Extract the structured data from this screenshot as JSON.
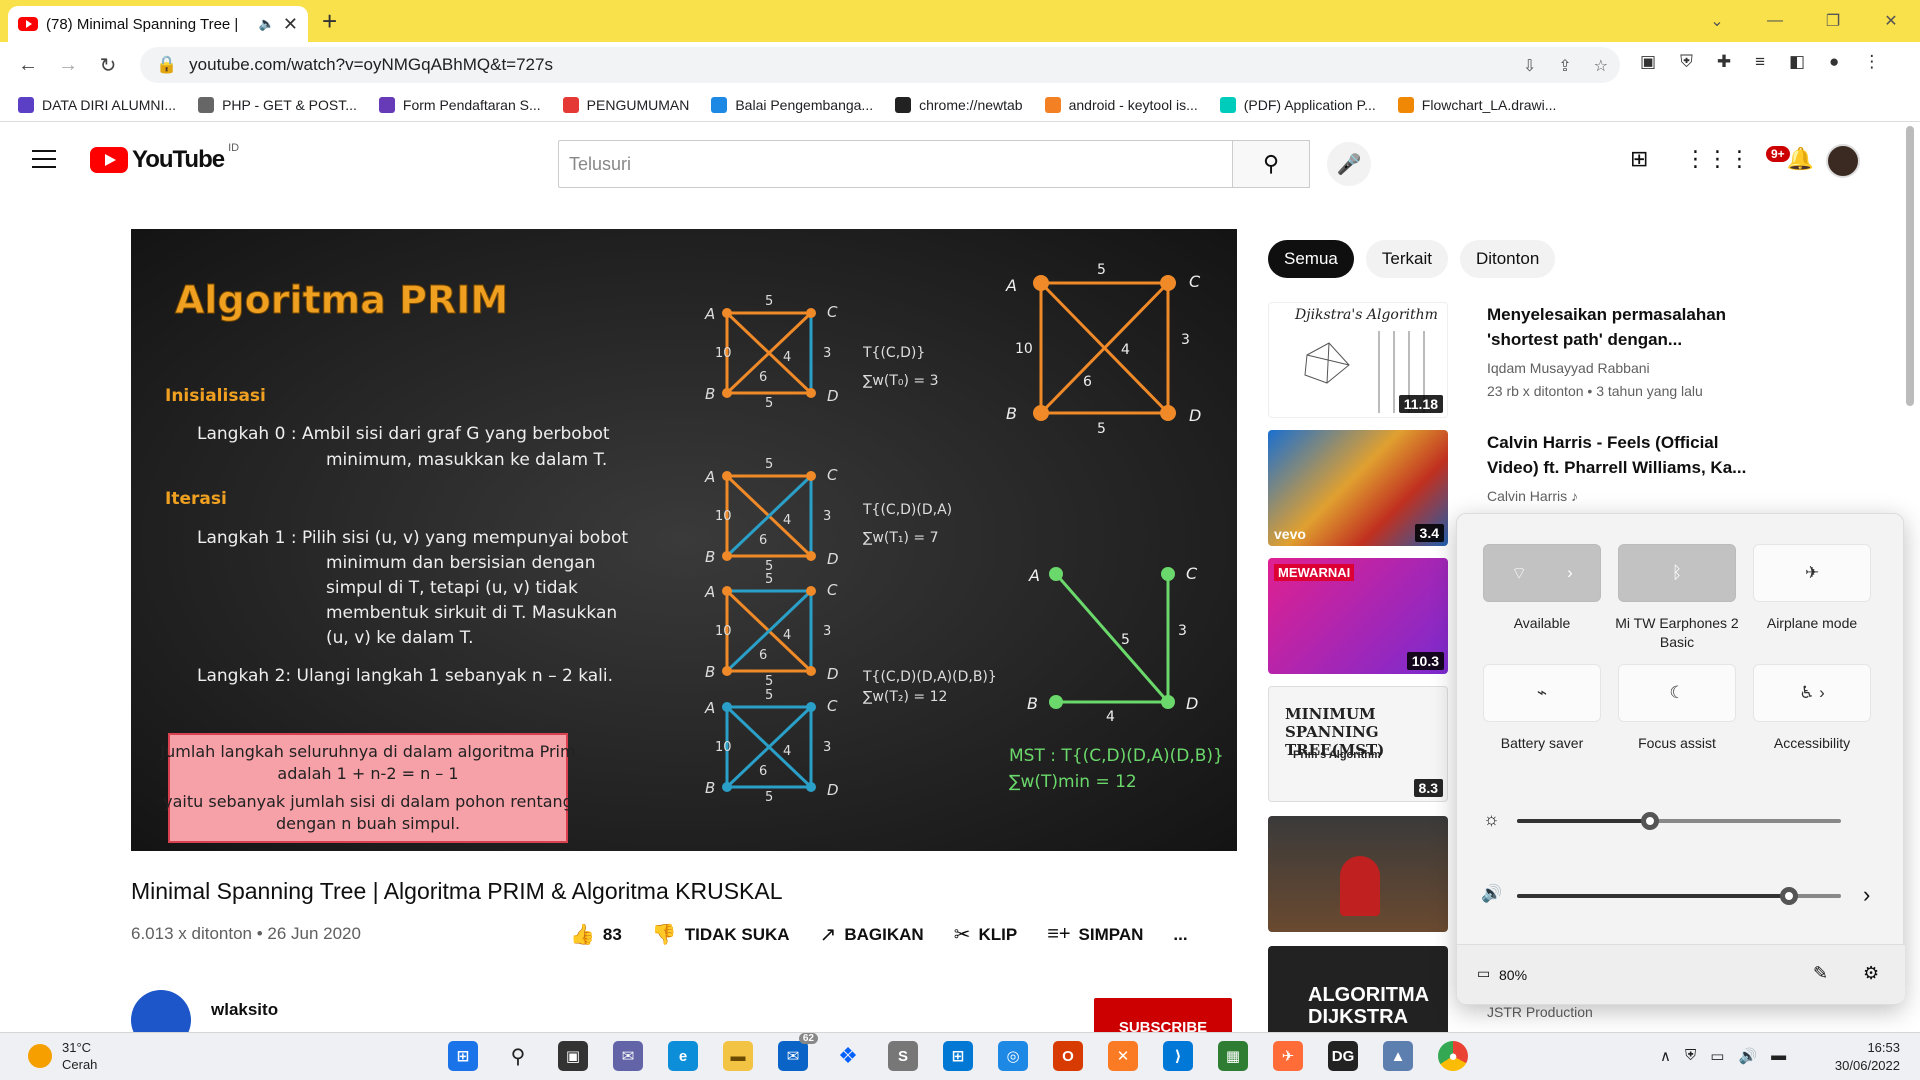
{
  "browser": {
    "tab_title": "(78) Minimal Spanning Tree |",
    "tab_close": "✕",
    "new_tab": "+",
    "url": "youtube.com/watch?v=oyNMGqABhMQ&t=727s",
    "bookmarks": [
      {
        "label": "DATA DIRI ALUMNI...",
        "color": "#5b3fc4"
      },
      {
        "label": "PHP - GET & POST...",
        "color": "#666666"
      },
      {
        "label": "Form Pendaftaran S...",
        "color": "#673ab7"
      },
      {
        "label": "PENGUMUMAN",
        "color": "#e53935"
      },
      {
        "label": "Balai Pengembanga...",
        "color": "#1e88e5"
      },
      {
        "label": "chrome://newtab",
        "color": "#222222"
      },
      {
        "label": "android - keytool is...",
        "color": "#f48024"
      },
      {
        "label": "(PDF) Application P...",
        "color": "#00ccbb"
      },
      {
        "label": "Flowchart_LA.drawi...",
        "color": "#f08705"
      }
    ]
  },
  "youtube": {
    "logo_text": "YouTube",
    "country": "ID",
    "search_placeholder": "Telusuri",
    "notif_count": "9+"
  },
  "video": {
    "title": "Minimal Spanning Tree | Algoritma PRIM & Algoritma KRUSKAL",
    "meta": "6.013 x ditonton • 26 Jun 2020",
    "likes": "83",
    "dislike_label": "TIDAK SUKA",
    "share_label": "BAGIKAN",
    "clip_label": "KLIP",
    "save_label": "SIMPAN",
    "more": "...",
    "channel": "wlaksito",
    "subscribe": "SUBSCRIBE"
  },
  "slide": {
    "heading": "Algoritma PRIM",
    "init_heading": "Inisialisasi",
    "step0_a": "Langkah 0 : Ambil sisi dari graf G yang berbobot",
    "step0_b": "minimum,  masukkan ke dalam T.",
    "iter_heading": "Iterasi",
    "step1_a": "Langkah 1 : Pilih sisi (u, v) yang mempunyai bobot",
    "step1_b": "minimum dan bersisian dengan",
    "step1_c": "simpul di T, tetapi (u, v) tidak",
    "step1_d": "membentuk sirkuit di T. Masukkan",
    "step1_e": "(u, v) ke dalam T.",
    "step2": "Langkah 2:    Ulangi langkah 1 sebanyak n – 2 kali.",
    "box_a": "Jumlah langkah seluruhnya di dalam algoritma Prim",
    "box_b": "adalah  1 + n-2 = n – 1",
    "box_c": "yaitu sebanyak jumlah sisi di dalam pohon rentang",
    "box_d": "dengan n buah simpul.",
    "t0_a": "T{(C,D)}",
    "t0_b": "∑w(T₀) = 3",
    "t1_a": "T{(C,D)(D,A)",
    "t1_b": "∑w(T₁) = 7",
    "t2_a": "T{(C,D)(D,A)(D,B)}",
    "t2_b": "∑w(T₂) = 12",
    "mst_a": "MST : T{(C,D)(D,A)(D,B)}",
    "mst_b": "∑w(T)min = 12"
  },
  "chips": [
    "Semua",
    "Terkait",
    "Ditonton"
  ],
  "related": [
    {
      "title_a": "Menyelesaikan permasalahan",
      "title_b": "'shortest path' dengan...",
      "channel": "Iqdam Musayyad Rabbani",
      "stats": "23 rb x ditonton • 3 tahun yang lalu",
      "duration": "11.18",
      "thumb_text": "Djikstra's Algorithm"
    },
    {
      "title_a": "Calvin Harris - Feels (Official",
      "title_b": "Video) ft. Pharrell Williams, Ka...",
      "channel": "Calvin Harris ♪",
      "duration": "3.4",
      "thumb_text": "vevo"
    },
    {
      "duration": "10.3",
      "thumb_text": "MEWARNAI"
    },
    {
      "duration": "8.3",
      "thumb_text": "MINIMUM SPANNING TREE(MST)",
      "thumb_sub": "Prim's Algorithm"
    },
    {
      "thumb_text": ""
    },
    {
      "channel": "JSTR Production",
      "thumb_text": "ALGORITMA DIJKSTRA"
    }
  ],
  "quick_settings": {
    "tiles": [
      {
        "label": "Available",
        "icon": "wifi-icon"
      },
      {
        "label": "Mi TW Earphones 2 Basic",
        "icon": "bluetooth-icon"
      },
      {
        "label": "Airplane mode",
        "icon": "airplane-icon"
      },
      {
        "label": "Battery saver",
        "icon": "battery-saver-icon"
      },
      {
        "label": "Focus assist",
        "icon": "moon-icon"
      },
      {
        "label": "Accessibility",
        "icon": "accessibility-icon"
      }
    ],
    "brightness": 0.41,
    "volume": 0.84,
    "battery": "80%"
  },
  "taskbar": {
    "temp": "31°C",
    "weather": "Cerah",
    "time": "16:53",
    "date": "30/06/2022",
    "mail_badge": "62"
  }
}
